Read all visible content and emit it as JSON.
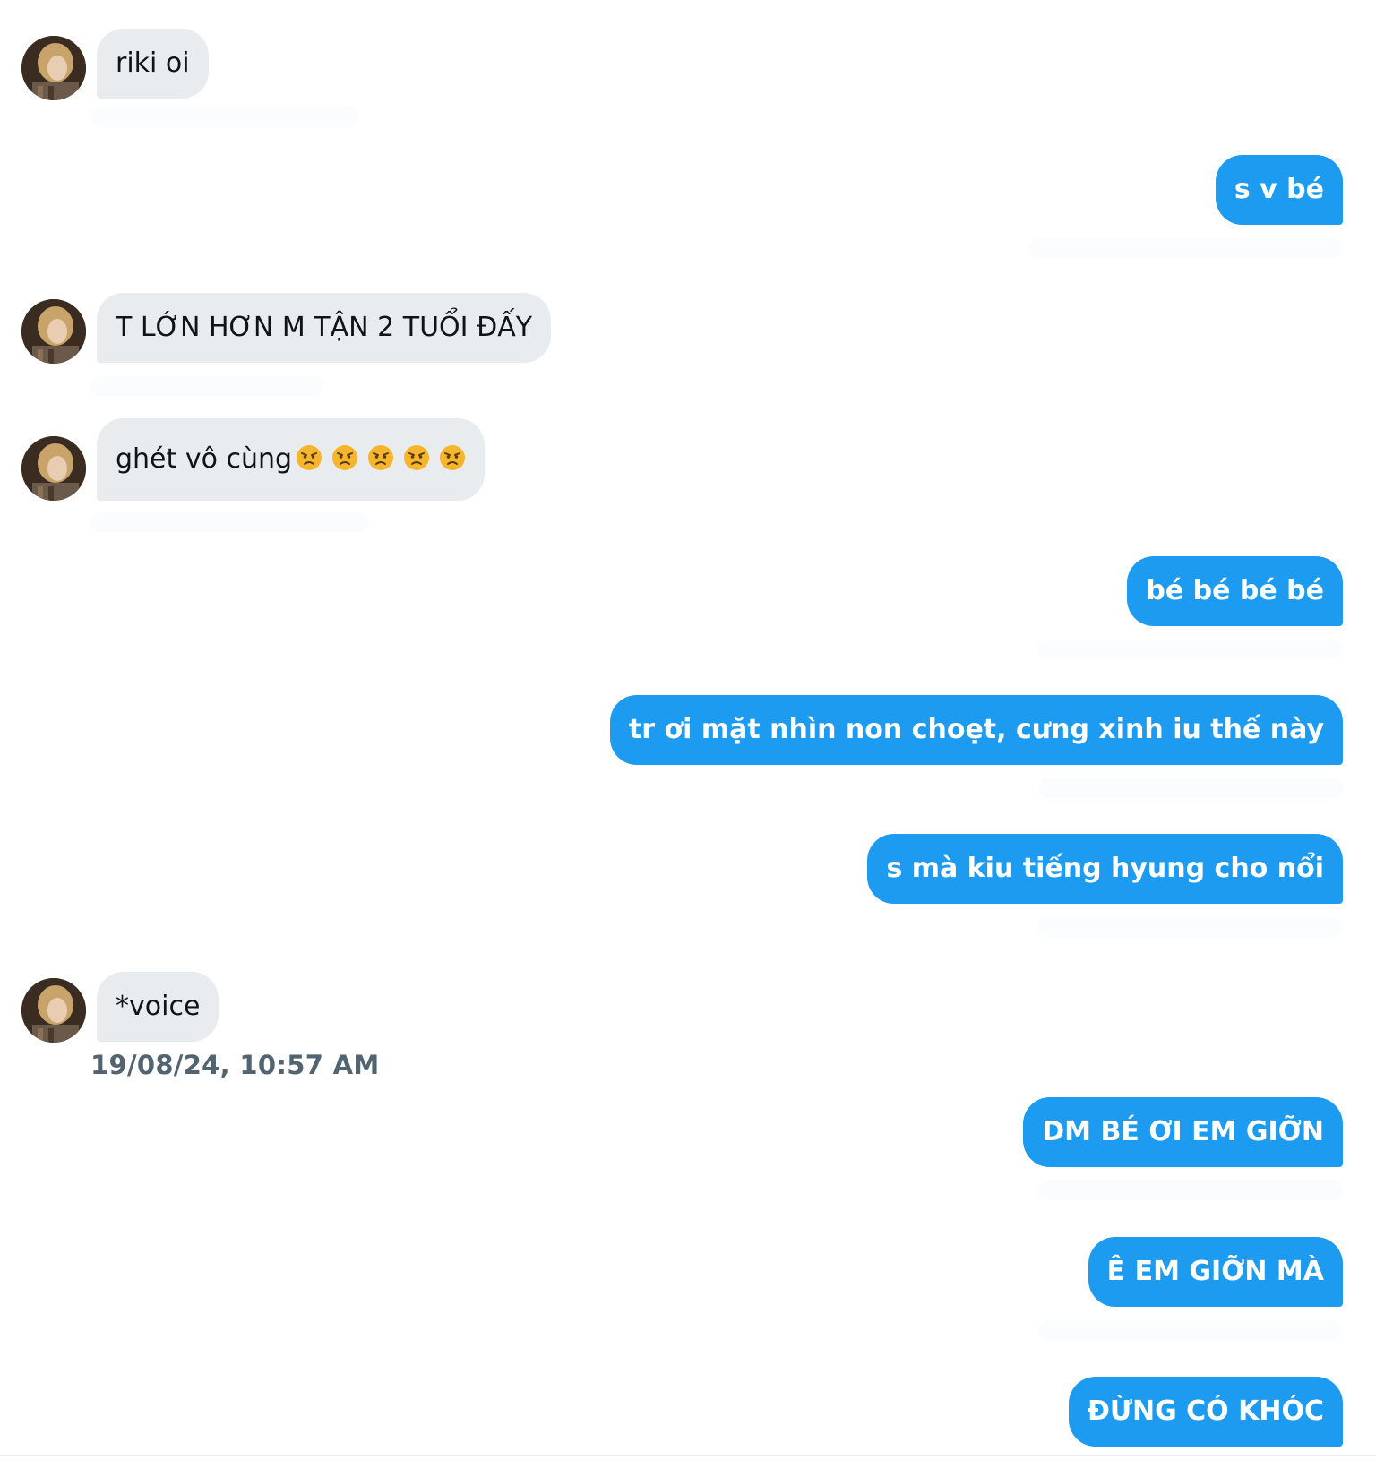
{
  "conversation": {
    "colors": {
      "incoming_bubble": "#e8ecef",
      "outgoing_bubble": "#1d9bf0",
      "incoming_text": "#0f1419",
      "outgoing_text": "#ffffff",
      "timestamp": "#536471"
    },
    "messages": [
      {
        "direction": "incoming",
        "text": "riki oi"
      },
      {
        "direction": "outgoing",
        "text": "s v bé"
      },
      {
        "direction": "incoming",
        "text": "T LỚN HƠN M TẬN 2 TUỔI ĐẤY"
      },
      {
        "direction": "incoming",
        "text": "ghét vô cùng",
        "emoji": [
          "angry-face-emoji",
          "angry-face-emoji",
          "angry-face-emoji",
          "angry-face-emoji",
          "angry-face-emoji"
        ]
      },
      {
        "direction": "outgoing",
        "text": "bé bé bé bé"
      },
      {
        "direction": "outgoing",
        "text": "tr ơi mặt nhìn non choẹt, cưng xinh iu thế này"
      },
      {
        "direction": "outgoing",
        "text": "s mà kiu tiếng hyung cho nổi"
      },
      {
        "direction": "incoming",
        "text": "*voice",
        "timestamp": "19/08/24, 10:57 AM"
      },
      {
        "direction": "outgoing",
        "text": "DM BÉ ƠI EM GIỠN"
      },
      {
        "direction": "outgoing",
        "text": "Ê EM GIỠN MÀ"
      },
      {
        "direction": "outgoing",
        "text": "ĐỪNG CÓ KHÓC"
      }
    ]
  }
}
